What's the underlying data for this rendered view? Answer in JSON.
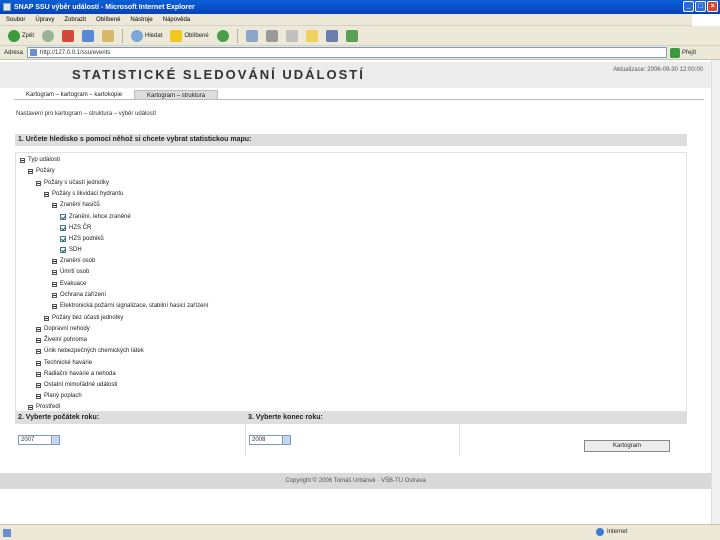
{
  "window": {
    "title": "SNAP SSU výběr událostí - Microsoft Internet Explorer",
    "buttons": [
      "_",
      "□",
      "×"
    ]
  },
  "menu": [
    "Soubor",
    "Úpravy",
    "Zobrazit",
    "Oblíbené",
    "Nástroje",
    "Nápověda"
  ],
  "toolbar": {
    "back_label": "Zpět",
    "search_label": "Hledat",
    "favorites_label": "Oblíbené"
  },
  "address": {
    "label": "Adresa",
    "url": "http://127.0.0.1/ssu/events",
    "go_label": "Přejít"
  },
  "header": {
    "title": "STATISTICKÉ SLEDOVÁNÍ UDÁLOSTÍ",
    "updated": "Aktualizace: 2006-09-30 12:00:00"
  },
  "tabs": [
    {
      "label": "Kartogram – kartogram – kartokopie"
    },
    {
      "label": "Kartogram – struktura"
    }
  ],
  "subtitle": "Nastavení pro kartogram – struktura – výběr událostí",
  "section1": {
    "heading": "1. Určete hledisko s pomocí něhož si chcete vybrat statistickou mapu:",
    "tree": [
      {
        "label": "Typ události",
        "kind": "exp"
      },
      {
        "label": "Požáry",
        "kind": "exp"
      },
      {
        "label": "Požáry s účastí jednotky",
        "kind": "exp"
      },
      {
        "label": "Požáry s likvidací hydrantu",
        "kind": "exp"
      },
      {
        "label": "Zranění hasičů",
        "kind": "exp"
      },
      {
        "label": "Zranění, lehce zraněné",
        "kind": "chk",
        "checked": true
      },
      {
        "label": "HZS ČR",
        "kind": "chk",
        "checked": true
      },
      {
        "label": "HZS podniků",
        "kind": "chk",
        "checked": true
      },
      {
        "label": "SDH",
        "kind": "chk",
        "checked": true
      },
      {
        "label": "Zranění osob",
        "kind": "exp"
      },
      {
        "label": "Úmrtí osob",
        "kind": "exp"
      },
      {
        "label": "Evakuace",
        "kind": "exp"
      },
      {
        "label": "Ochrana zařízení",
        "kind": "exp"
      },
      {
        "label": "Elektronická požární signalizace, stabilní hasicí zařízení",
        "kind": "exp"
      },
      {
        "label": "Požáry bez účasti jednotky",
        "kind": "exp"
      },
      {
        "label": "Dopravní nehody",
        "kind": "exp"
      },
      {
        "label": "Živelní pohroma",
        "kind": "exp"
      },
      {
        "label": "Únik nebezpečných chemických látek",
        "kind": "exp"
      },
      {
        "label": "Technické havárie",
        "kind": "exp"
      },
      {
        "label": "Radiační havárie a nehoda",
        "kind": "exp"
      },
      {
        "label": "Ostatní mimořádné události",
        "kind": "exp"
      },
      {
        "label": "Planý poplach",
        "kind": "exp"
      },
      {
        "label": "Prostředí",
        "kind": "exp"
      }
    ]
  },
  "section2": {
    "heading": "2. Vyberte počátek roku:",
    "value": "2007"
  },
  "section3": {
    "heading": "3. Vyberte konec roku:",
    "value": "2008"
  },
  "draw_button": "Kartogram",
  "footer": "Copyright © 2006 Tomáš Urbánek · VŠB-TU Ostrava",
  "status": {
    "zone": "Internet"
  },
  "colors": {
    "titlebar": "#0842b8",
    "chrome": "#ece9d8",
    "section": "#dedede"
  }
}
